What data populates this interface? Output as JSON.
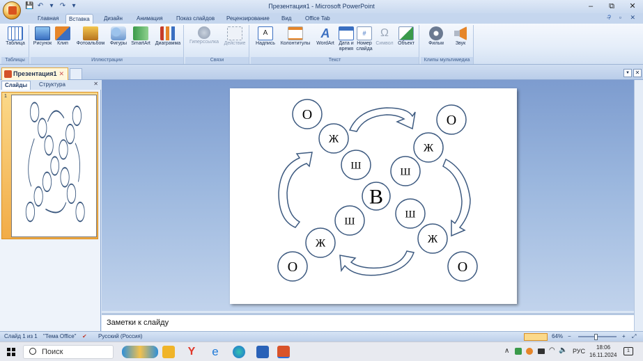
{
  "window": {
    "title": "Презентация1 - Microsoft PowerPoint",
    "minimize": "–",
    "restore": "⧉",
    "close": "✕"
  },
  "qat": {
    "save": "💾",
    "undo": "↶",
    "undo_drop": "▾",
    "redo": "↷",
    "customize": "▾"
  },
  "tabs": [
    "Главная",
    "Вставка",
    "Дизайн",
    "Анимация",
    "Показ слайдов",
    "Рецензирование",
    "Вид",
    "Office Tab"
  ],
  "active_tab": "Вставка",
  "help": "?",
  "mini_ctrls": "–  ▫  ✕",
  "ribbon": {
    "groups": {
      "tables": "Таблицы",
      "illustrations": "Иллюстрации",
      "links": "Связи",
      "text": "Текст",
      "media": "Клипы мультимедиа"
    },
    "buttons": {
      "table": "Таблица",
      "picture": "Рисунок",
      "clip": "Клип",
      "photo_album": "Фотоальбом",
      "shapes": "Фигуры",
      "smartart": "SmartArt",
      "chart": "Диаграмма",
      "hyperlink": "Гиперссылка",
      "action": "Действие",
      "textbox": "Надпись",
      "header_footer": "Колонтитулы",
      "wordart": "WordArt",
      "date_time_1": "Дата и",
      "date_time_2": "время",
      "slide_number_1": "Номер",
      "slide_number_2": "слайда",
      "symbol": "Символ",
      "object": "Объект",
      "movie": "Фильм",
      "sound": "Звук"
    },
    "icon_colors": {
      "blue": "#3a6fc1",
      "orange": "#e6862a",
      "green": "#3a9a4a",
      "red": "#c63c2a",
      "gray": "#9aa7b8"
    }
  },
  "document_tab": {
    "label": "Презентация1",
    "close": "✕"
  },
  "left_pane": {
    "tab_slides": "Слайды",
    "tab_outline": "Структура",
    "close": "✕",
    "slide_number": "1"
  },
  "slide": {
    "center": "В",
    "outer_letter": "О",
    "mid_letter": "Ж",
    "inner_letter": "Ш",
    "accent_color": "#3d5a80"
  },
  "notes": {
    "placeholder": "Заметки к слайду"
  },
  "status": {
    "slide_info": "Слайд 1 из 1",
    "theme": "\"Тема Office\"",
    "language": "Русский (Россия)",
    "zoom": "64%",
    "zoom_minus": "−",
    "zoom_plus": "+"
  },
  "taskbar": {
    "search_label": "Поиск",
    "language": "РУС",
    "time": "18:06",
    "date": "16.11.2024",
    "chevron": "∧",
    "notification_count": "1"
  }
}
